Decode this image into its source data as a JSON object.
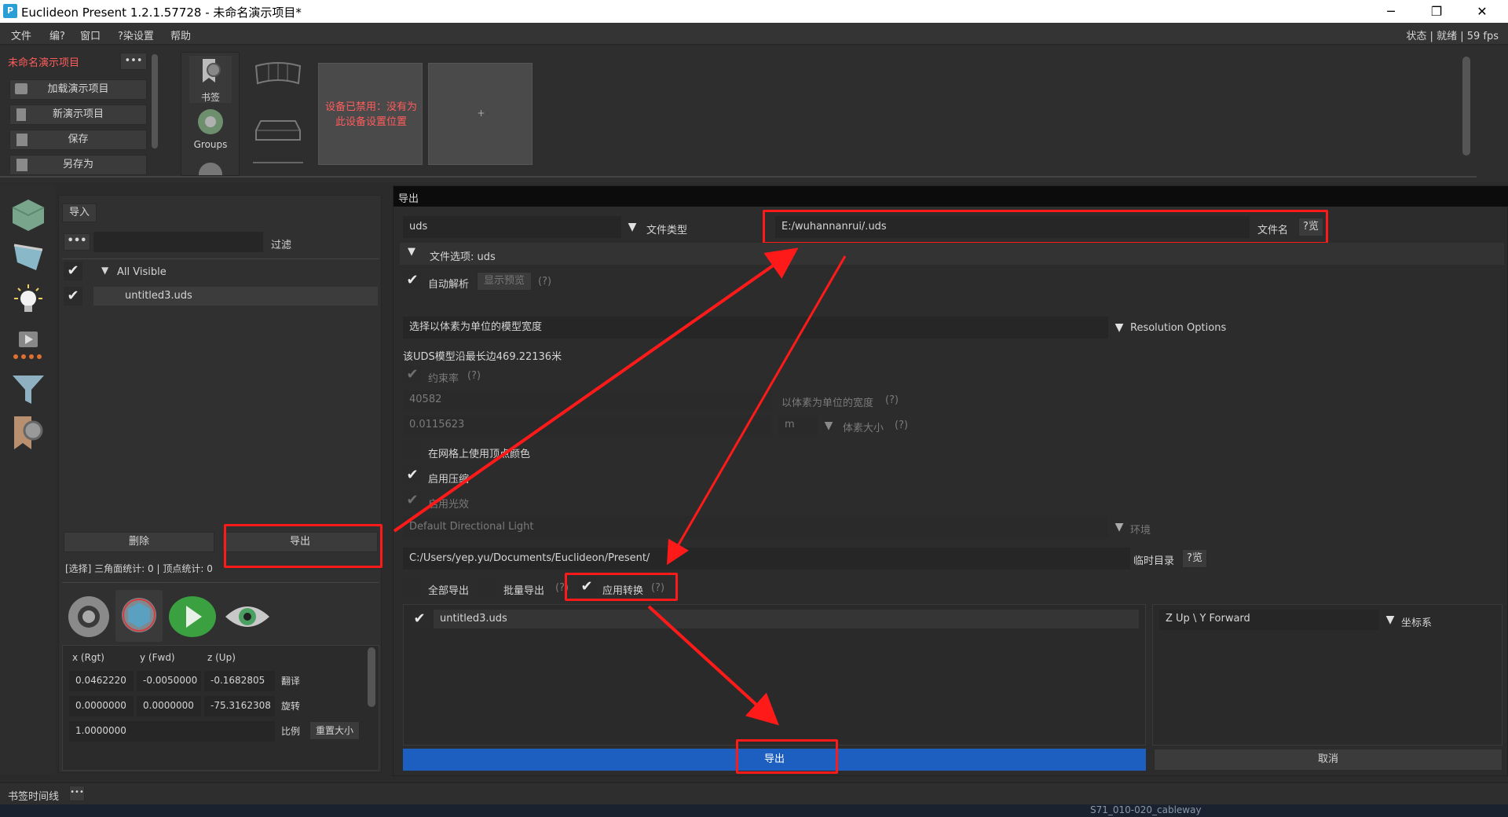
{
  "window": {
    "app_icon": "P",
    "title": "Euclideon Present 1.2.1.57728 - 未命名演示项目*",
    "min": "─",
    "max": "❐",
    "close": "✕"
  },
  "menu": {
    "items": [
      "文件",
      "编?",
      "窗口",
      "?染设置",
      "帮助"
    ],
    "status": "状态 | 就绪 | 59 fps"
  },
  "project": {
    "name": "未命名演示项目",
    "more": "•••",
    "buttons": [
      "加载演示项目",
      "新演示项目",
      "保存",
      "另存为"
    ]
  },
  "toolbox": {
    "bookmarks_label": "书签",
    "groups_label": "Groups"
  },
  "device": {
    "disabled_text": "设备已禁用：没有为此设备设置位置",
    "add": "+"
  },
  "scene": {
    "import_label": "导入",
    "more": "•••",
    "filter_label": "过滤",
    "tree_root": "All Visible",
    "tree_item": "untitled3.uds",
    "delete_label": "删除",
    "export_label": "导出",
    "stats": "[选择] 三角面统计: 0 |   顶点统计: 0"
  },
  "transform": {
    "headers": [
      "x (Rgt)",
      "y (Fwd)",
      "z (Up)"
    ],
    "translate": [
      "0.0462220",
      "-0.0050000",
      "-0.1682805"
    ],
    "translate_label": "翻译",
    "rotate": [
      "0.0000000",
      "0.0000000",
      "-75.3162308"
    ],
    "rotate_label": "旋转",
    "scale": "1.0000000",
    "scale_label": "比例",
    "reset_label": "重置大小"
  },
  "export_dialog": {
    "title": "导出",
    "file_type_value": "uds",
    "file_type_label": "文件类型",
    "filename_value": "E:/wuhannanrui/.uds",
    "filename_label": "文件名",
    "browse": "?览",
    "options_header": "文件选项: uds",
    "auto_parse": "自动解析",
    "show_preview": "显示预览",
    "help": "(?)",
    "resolution_select": "选择以体素为单位的模型宽度",
    "resolution_label": "Resolution Options",
    "longest_edge": "该UDS模型沿最长边469.22136米",
    "constrain": "约束率",
    "width_value": "40582",
    "width_label": "以体素为单位的宽度",
    "voxel_value": "0.0115623",
    "unit": "m",
    "voxel_label": "体素大小",
    "vertex_color": "在网格上使用顶点颜色",
    "compression": "启用压缩",
    "lighting": "启用光效",
    "light_value": "Default Directional Light",
    "env_label": "环境",
    "temp_dir_value": "C:/Users/yep.yu/Documents/Euclideon/Present/",
    "temp_dir_label": "临时目录",
    "export_all": "全部导出",
    "batch_export": "批量导出",
    "apply_transform": "应用转换",
    "list_item": "untitled3.uds",
    "coord_value": "Z Up \\ Y Forward",
    "coord_label": "坐标系",
    "export_button": "导出",
    "cancel_button": "取消"
  },
  "bottom": {
    "timeline_label": "书签时间线",
    "more": "•••",
    "taskbar_text": "S71_010-020_cableway"
  },
  "colors": {
    "accent_blue": "#1c5fc0",
    "highlight_red": "#ff1a1a",
    "disabled_red": "#ff5c5c"
  }
}
